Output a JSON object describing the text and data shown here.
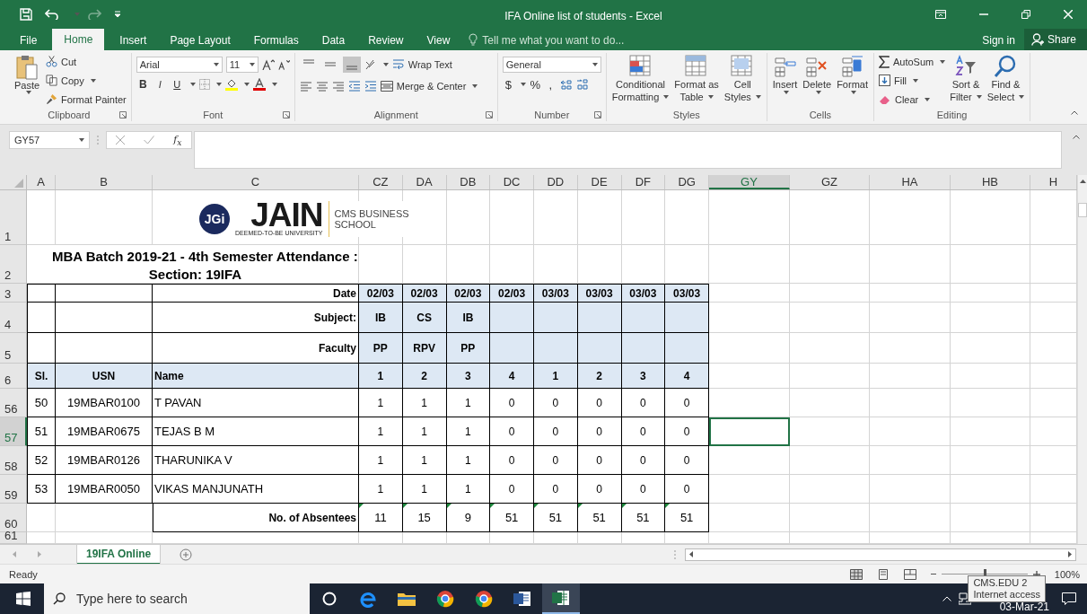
{
  "window": {
    "title": "IFA Online list of students - Excel",
    "redo": {
      "disabled": true
    }
  },
  "ribbon_tabs": [
    {
      "label": "File",
      "selected": false
    },
    {
      "label": "Home",
      "selected": true
    },
    {
      "label": "Insert",
      "selected": false
    },
    {
      "label": "Page Layout",
      "selected": false
    },
    {
      "label": "Formulas",
      "selected": false
    },
    {
      "label": "Data",
      "selected": false
    },
    {
      "label": "Review",
      "selected": false
    },
    {
      "label": "View",
      "selected": false
    }
  ],
  "tell_me": {
    "placeholder": "Tell me what you want to do..."
  },
  "account": {
    "sign_in": "Sign in",
    "share": "Share"
  },
  "ribbon": {
    "clipboard": {
      "label": "Clipboard",
      "paste": "Paste",
      "cut": "Cut",
      "copy": "Copy",
      "format_painter": "Format Painter"
    },
    "font": {
      "label": "Font",
      "name": "Arial",
      "size": "11",
      "bold": "B",
      "italic": "I",
      "underline": "U"
    },
    "alignment": {
      "label": "Alignment",
      "wrap_text": "Wrap Text",
      "merge_center": "Merge & Center",
      "vertical": [
        {
          "selected": false
        },
        {
          "selected": false
        },
        {
          "selected": true
        }
      ]
    },
    "number": {
      "label": "Number",
      "format": "General",
      "currency": "$",
      "percent": "%",
      "comma": ","
    },
    "styles": {
      "label": "Styles",
      "buttons": [
        {
          "kind": "conditional",
          "lines": [
            "Conditional",
            "Formatting"
          ]
        },
        {
          "kind": "table",
          "lines": [
            "Format as",
            "Table"
          ]
        },
        {
          "kind": "cellstyles",
          "lines": [
            "Cell",
            "Styles"
          ]
        }
      ]
    },
    "cells": {
      "label": "Cells",
      "buttons": [
        {
          "kind": "insert",
          "label": "Insert"
        },
        {
          "kind": "delete",
          "label": "Delete"
        },
        {
          "kind": "format",
          "label": "Format"
        }
      ]
    },
    "editing": {
      "label": "Editing",
      "autosum": "AutoSum",
      "fill": "Fill",
      "clear": "Clear",
      "sort_filter": [
        "Sort &",
        "Filter"
      ],
      "find_select": [
        "Find &",
        "Select"
      ]
    }
  },
  "formula_bar": {
    "name_box": "GY57",
    "fx": "f$_{x}$"
  },
  "sheet": {
    "columns": [
      {
        "label": "A",
        "selected": false
      },
      {
        "label": "B",
        "selected": false
      },
      {
        "label": "C",
        "selected": false
      },
      {
        "label": "CZ",
        "selected": false
      },
      {
        "label": "DA",
        "selected": false
      },
      {
        "label": "DB",
        "selected": false
      },
      {
        "label": "DC",
        "selected": false
      },
      {
        "label": "DD",
        "selected": false
      },
      {
        "label": "DE",
        "selected": false
      },
      {
        "label": "DF",
        "selected": false
      },
      {
        "label": "DG",
        "selected": false
      },
      {
        "label": "GY",
        "selected": true
      },
      {
        "label": "GZ",
        "selected": false
      },
      {
        "label": "HA",
        "selected": false
      },
      {
        "label": "HB",
        "selected": false
      },
      {
        "label": "H",
        "selected": false
      }
    ],
    "logo": {
      "badge": "JGi",
      "name": "JAIN",
      "tagline": "DEEMED-TO-BE UNIVERSITY",
      "school": [
        "CMS BUSINESS",
        "SCHOOL"
      ]
    },
    "rows": [
      {
        "number": "1",
        "kind": "logo",
        "selected": false
      },
      {
        "number": "2",
        "kind": "title",
        "selected": false,
        "lines": [
          "MBA Batch 2019-21 - 4th Semester Attendance :",
          "Section: 19IFA"
        ]
      },
      {
        "number": "3",
        "kind": "header",
        "selected": false,
        "label": "Date",
        "values": [
          "02/03",
          "02/03",
          "02/03",
          "02/03",
          "03/03",
          "03/03",
          "03/03",
          "03/03"
        ]
      },
      {
        "number": "4",
        "kind": "header",
        "selected": false,
        "label": "Subject:",
        "values": [
          "IB",
          "CS",
          "IB"
        ]
      },
      {
        "number": "5",
        "kind": "header",
        "selected": false,
        "label": "Faculty",
        "values": [
          "PP",
          "RPV",
          "PP"
        ]
      },
      {
        "number": "6",
        "kind": "columns",
        "selected": false,
        "sl": "Sl.",
        "usn": "USN",
        "name": "Name",
        "values": [
          "1",
          "2",
          "3",
          "4",
          "1",
          "2",
          "3",
          "4"
        ]
      },
      {
        "number": "56",
        "kind": "student",
        "selected": false,
        "sl": "50",
        "usn": "19MBAR0100",
        "name": "T PAVAN",
        "values": [
          "1",
          "1",
          "1",
          "0",
          "0",
          "0",
          "0",
          "0"
        ]
      },
      {
        "number": "57",
        "kind": "student",
        "selected": true,
        "sl": "51",
        "usn": "19MBAR0675",
        "name": "TEJAS B M",
        "values": [
          "1",
          "1",
          "1",
          "0",
          "0",
          "0",
          "0",
          "0"
        ]
      },
      {
        "number": "58",
        "kind": "student",
        "selected": false,
        "sl": "52",
        "usn": "19MBAR0126",
        "name": "THARUNIKA V",
        "values": [
          "1",
          "1",
          "1",
          "0",
          "0",
          "0",
          "0",
          "0"
        ]
      },
      {
        "number": "59",
        "kind": "student",
        "selected": false,
        "sl": "53",
        "usn": "19MBAR0050",
        "name": "VIKAS MANJUNATH",
        "values": [
          "1",
          "1",
          "1",
          "0",
          "0",
          "0",
          "0",
          "0"
        ]
      },
      {
        "number": "60",
        "kind": "total",
        "selected": false,
        "label": "No. of Absentees",
        "values": [
          "11",
          "15",
          "9",
          "51",
          "51",
          "51",
          "51",
          "51"
        ]
      },
      {
        "number": "61",
        "kind": "blank",
        "selected": false
      }
    ]
  },
  "sheet_tabs": [
    {
      "label": "19IFA Online",
      "selected": true
    }
  ],
  "status_bar": {
    "status": "Ready",
    "zoom": {
      "level": 0.5,
      "reading": "100%"
    }
  },
  "taskbar": {
    "search_placeholder": "Type here to search",
    "apps": [
      {
        "kind": "cortana",
        "selected": false
      },
      {
        "kind": "edge",
        "selected": false
      },
      {
        "kind": "explorer",
        "selected": false
      },
      {
        "kind": "chrome",
        "selected": false
      },
      {
        "kind": "chrome",
        "selected": false
      },
      {
        "kind": "word",
        "selected": false
      },
      {
        "kind": "excel",
        "selected": true
      }
    ],
    "date": "03-Mar-21",
    "tooltip": [
      "CMS.EDU 2",
      "Internet access"
    ]
  }
}
